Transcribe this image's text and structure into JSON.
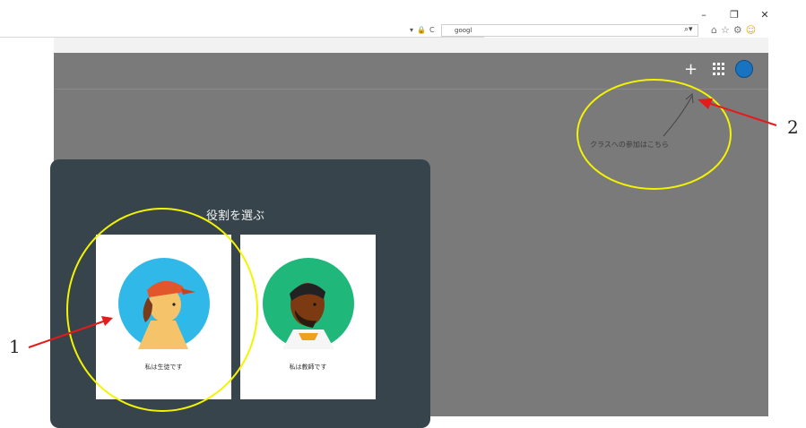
{
  "browser": {
    "window_controls": [
      "–",
      "❐",
      "✕"
    ],
    "address_tools": [
      "▾",
      "🔒",
      "C"
    ],
    "search_value": "googl",
    "search_icon": "⌕▾",
    "toolbar_icons": [
      "⌂",
      "☆",
      "⚙",
      "☺"
    ]
  },
  "classroom": {
    "topbar": {
      "plus": "+",
      "apps_icon": "apps-icon"
    },
    "join_hint": "クラスへの参加はこちら",
    "dialog": {
      "title": "役割を選ぶ",
      "student_card": {
        "label": "私は生徒です"
      },
      "teacher_card": {
        "label": "私は教師です"
      }
    }
  },
  "annotations": {
    "marker_1": "1",
    "marker_2": "2"
  },
  "colors": {
    "overlay": "#7a7a7a",
    "dialog": "#37444c",
    "highlight": "#f4f400",
    "arrow": "#e51a1a"
  }
}
